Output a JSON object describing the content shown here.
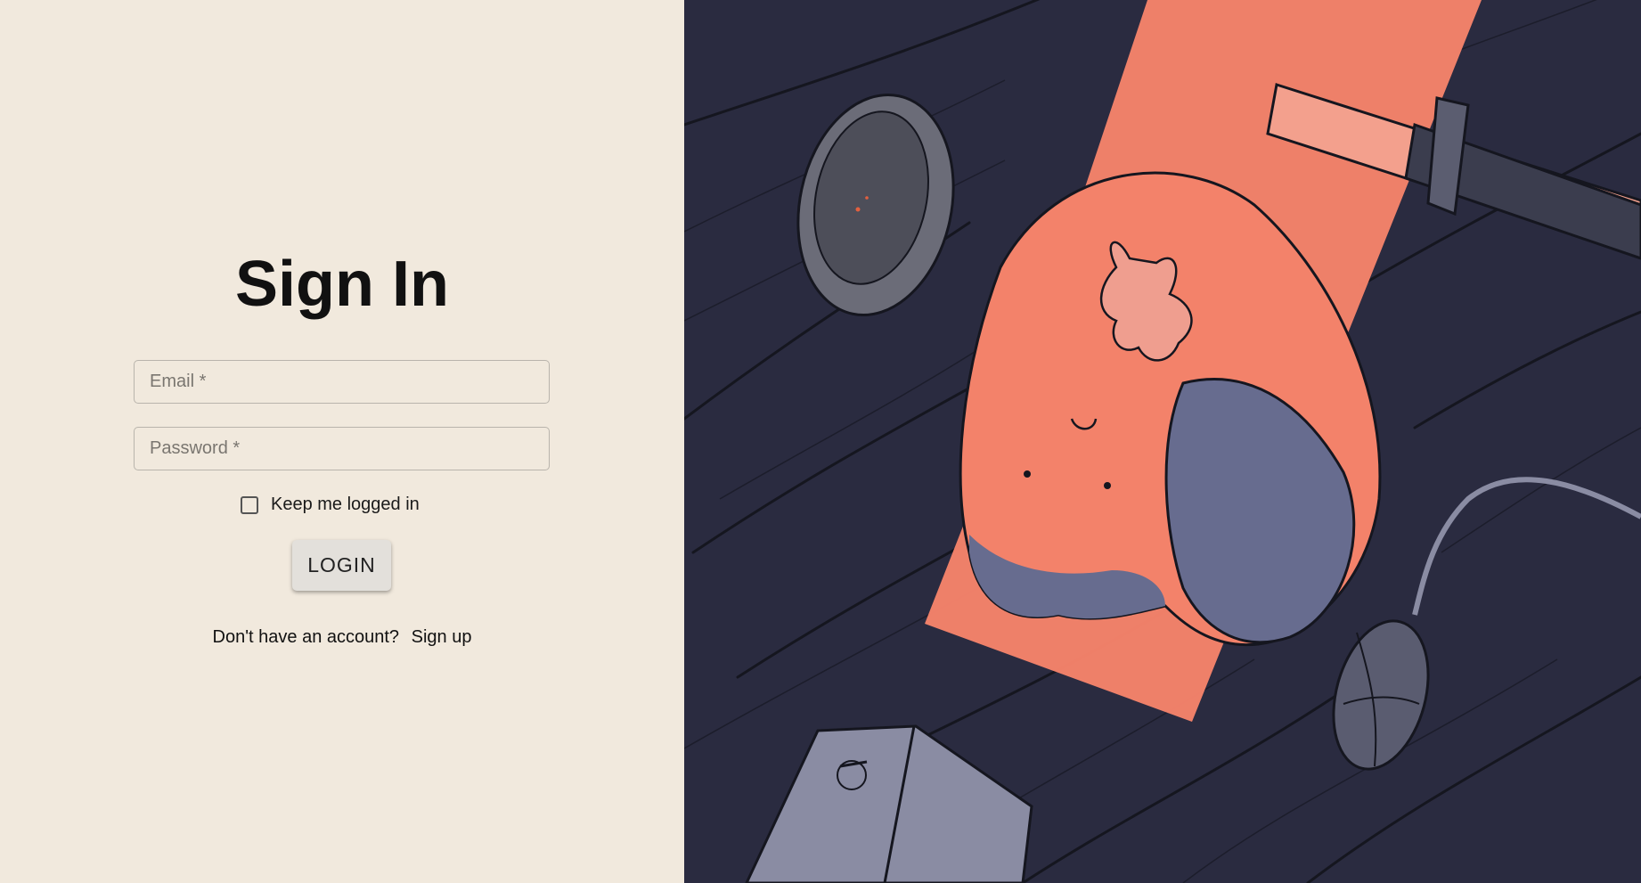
{
  "signin": {
    "title": "Sign In",
    "email_placeholder": "Email *",
    "password_placeholder": "Password *",
    "remember_label": "Keep me logged in",
    "login_label": "LOGIN",
    "no_account_text": "Don't have an account?",
    "signup_link": "Sign up"
  },
  "colors": {
    "left_bg": "#f1e9dd",
    "right_bg": "#2a2b40",
    "cat_orange": "#f3826a",
    "cat_shadow": "#676c8f"
  }
}
